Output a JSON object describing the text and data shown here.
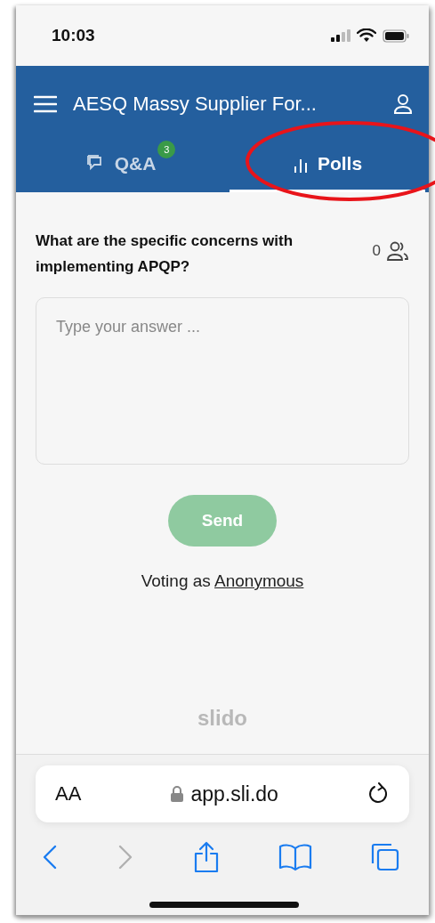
{
  "status_bar": {
    "time": "10:03"
  },
  "header": {
    "title": "AESQ Massy Supplier For..."
  },
  "tabs": [
    {
      "kind": "qa",
      "label": "Q&A",
      "badge": "3",
      "selected": false
    },
    {
      "kind": "polls",
      "label": "Polls",
      "selected": true
    }
  ],
  "poll": {
    "question": "What are the specific concerns with implementing APQP?",
    "participants": "0",
    "answer_placeholder": "Type your answer ...",
    "send_label": "Send",
    "send_disabled": true,
    "voting_prefix": "Voting as",
    "voting_name": "Anonymous"
  },
  "brand": "slido",
  "browser": {
    "text_size": "AA",
    "url": "app.sli.do"
  },
  "toolbar": [
    {
      "kind": "back",
      "disabled": false
    },
    {
      "kind": "forward",
      "disabled": true
    },
    {
      "kind": "share",
      "disabled": false
    },
    {
      "kind": "bookmarks",
      "disabled": false
    },
    {
      "kind": "tabs",
      "disabled": false
    }
  ]
}
